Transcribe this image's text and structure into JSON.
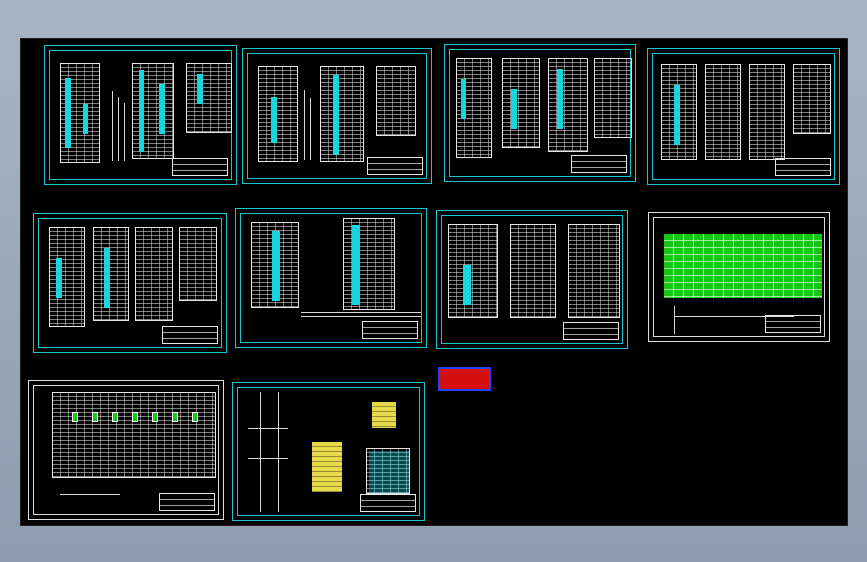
{
  "viewer": {
    "background": "black",
    "accent_line": "#17c6cf"
  },
  "sheets": [
    {
      "name": "drawing-sheet-1",
      "frame": "cyan"
    },
    {
      "name": "drawing-sheet-2",
      "frame": "cyan"
    },
    {
      "name": "drawing-sheet-3",
      "frame": "cyan"
    },
    {
      "name": "drawing-sheet-4",
      "frame": "cyan"
    },
    {
      "name": "drawing-sheet-5",
      "frame": "cyan"
    },
    {
      "name": "drawing-sheet-6",
      "frame": "cyan"
    },
    {
      "name": "drawing-sheet-7",
      "frame": "cyan"
    },
    {
      "name": "drawing-sheet-8",
      "frame": "white"
    },
    {
      "name": "drawing-sheet-9",
      "frame": "white"
    },
    {
      "name": "drawing-sheet-10",
      "frame": "cyan"
    }
  ],
  "stamp": {
    "line1": "",
    "line2": "",
    "line3": "",
    "color": "#d61010",
    "border_color": "#2244ff"
  }
}
